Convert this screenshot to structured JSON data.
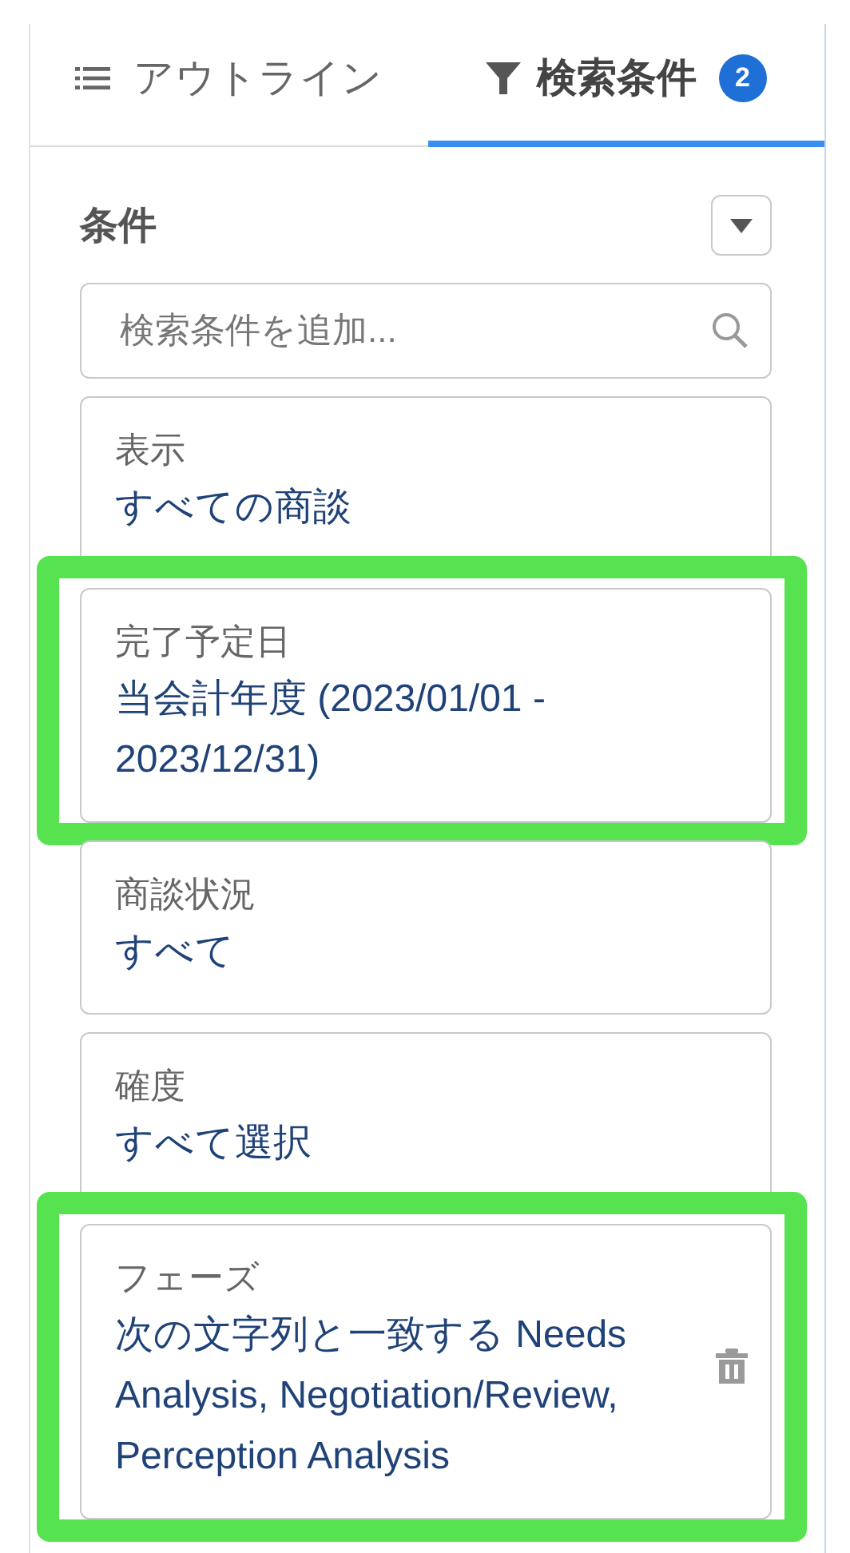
{
  "tabs": [
    {
      "label": "アウトライン",
      "selected": false
    },
    {
      "label": "検索条件",
      "badge": "2",
      "selected": true
    }
  ],
  "section": {
    "title": "条件"
  },
  "search": {
    "placeholder": "検索条件を追加..."
  },
  "conditions": [
    {
      "label": "表示",
      "value": "すべての商談",
      "highlighted": false,
      "removable": false
    },
    {
      "label": "完了予定日",
      "value": "当会計年度 (2023/01/01 - 2023/12/31)",
      "highlighted": true,
      "removable": false
    },
    {
      "label": "商談状況",
      "value": "すべて",
      "highlighted": false,
      "removable": false
    },
    {
      "label": "確度",
      "value": "すべて選択",
      "highlighted": false,
      "removable": false
    },
    {
      "label": "フェーズ",
      "value": "次の文字列と一致する Needs Analysis, Negotiation/Review, Perception Analysis",
      "highlighted": true,
      "removable": true
    }
  ]
}
